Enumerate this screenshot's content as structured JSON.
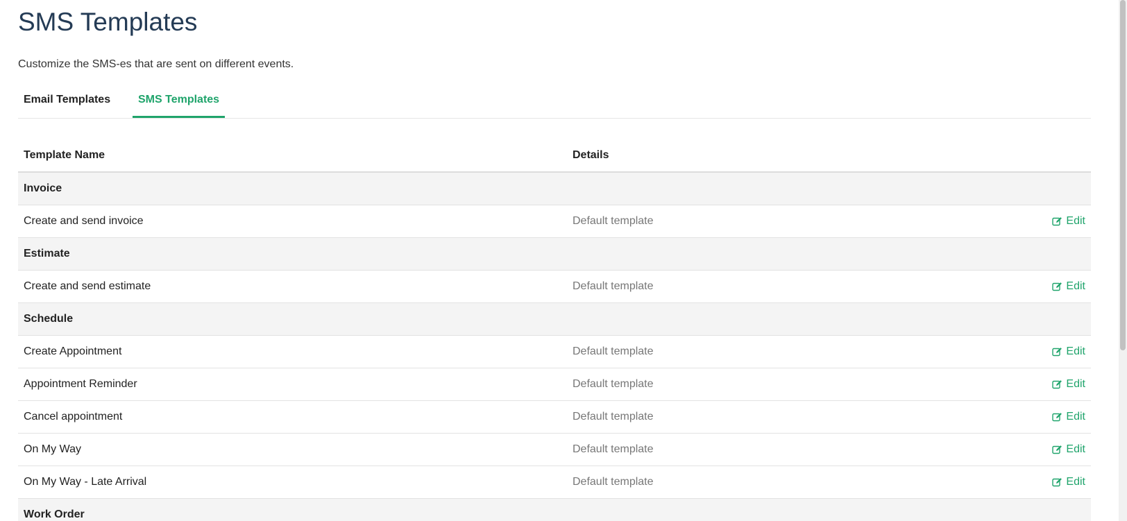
{
  "page": {
    "title": "SMS Templates",
    "subtitle": "Customize the SMS-es that are sent on different events."
  },
  "tabs": [
    {
      "label": "Email Templates",
      "active": false
    },
    {
      "label": "SMS Templates",
      "active": true
    }
  ],
  "table": {
    "headers": {
      "name": "Template Name",
      "details": "Details"
    },
    "edit_label": "Edit",
    "rows": [
      {
        "type": "group",
        "name": "Invoice"
      },
      {
        "type": "item",
        "name": "Create and send invoice",
        "details": "Default template"
      },
      {
        "type": "group",
        "name": "Estimate"
      },
      {
        "type": "item",
        "name": "Create and send estimate",
        "details": "Default template"
      },
      {
        "type": "group",
        "name": "Schedule"
      },
      {
        "type": "item",
        "name": "Create Appointment",
        "details": "Default template"
      },
      {
        "type": "item",
        "name": "Appointment Reminder",
        "details": "Default template"
      },
      {
        "type": "item",
        "name": "Cancel appointment",
        "details": "Default template"
      },
      {
        "type": "item",
        "name": "On My Way",
        "details": "Default template"
      },
      {
        "type": "item",
        "name": "On My Way - Late Arrival",
        "details": "Default template"
      },
      {
        "type": "group",
        "name": "Work Order"
      }
    ]
  },
  "colors": {
    "accent": "#1fa46b",
    "title": "#243b55",
    "group_bg": "#f4f4f4",
    "muted": "#777777"
  },
  "icons": {
    "edit": "edit-icon"
  }
}
